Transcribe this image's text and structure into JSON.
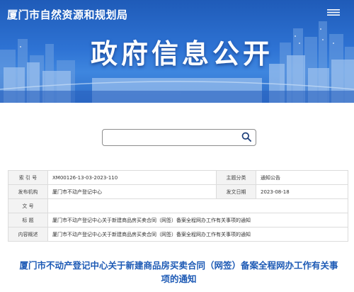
{
  "header": {
    "site_title": "厦门市自然资源和规划局",
    "hero_title": "政府信息公开"
  },
  "search": {
    "placeholder": ""
  },
  "info": {
    "index_label": "索  引  号",
    "index_value": "XM00126-13-03-2023-110",
    "topic_label": "主题分类",
    "topic_value": "通知公告",
    "publisher_label": "发布机构",
    "publisher_value": "厦门市不动产登记中心",
    "date_label": "发文日期",
    "date_value": "2023-08-18",
    "docno_label": "文    号",
    "docno_value": "",
    "subject_label": "标    题",
    "subject_value": "厦门市不动产登记中心关于新建商品房买卖合同（网签）备案全程网办工作有关事项的通知",
    "summary_label": "内容概述",
    "summary_value": "厦门市不动产登记中心关于新建商品房买卖合同（网签）备案全程网办工作有关事项的通知"
  },
  "article": {
    "title": "厦门市不动产登记中心关于新建商品房买卖合同（网签）备案全程网办工作有关事项的通知"
  },
  "icons": {
    "search": "search-icon",
    "menu": "menu-icon"
  },
  "colors": {
    "banner": "#2e73d4",
    "title_blue": "#1d5ab5",
    "label_bg": "#f3f3f3"
  }
}
